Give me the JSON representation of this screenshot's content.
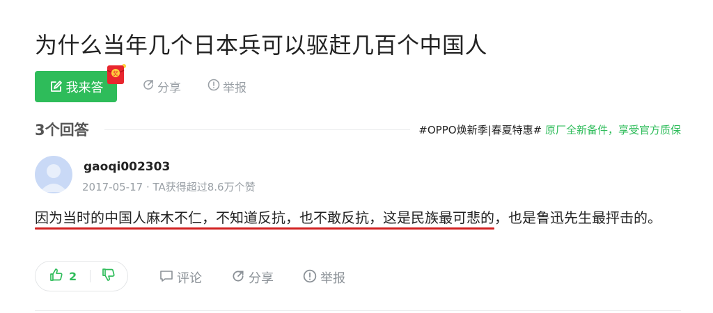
{
  "question": {
    "title": "为什么当年几个日本兵可以驱赶几百个中国人"
  },
  "actions": {
    "answer_label": "我来答",
    "share_label": "分享",
    "report_label": "举报",
    "redpacket_char": "奖"
  },
  "answers_header": {
    "count_label": "3个回答",
    "ad_tag": "#OPPO焕新季|春夏特惠#",
    "ad_text": "原厂全新备件，享受官方质保"
  },
  "answer": {
    "username": "gaoqi002303",
    "meta": "2017-05-17 · TA获得超过8.6万个赞",
    "text_highlighted": "因为当时的中国人麻木不仁，不知道反抗，也不敢反抗，这是民族最可悲的",
    "text_rest": "，也是鲁迅先生最抨击的。",
    "likes": "2",
    "comment_label": "评论",
    "share_label": "分享",
    "report_label": "举报"
  },
  "colors": {
    "accent_green": "#2ebc5a",
    "highlight_red": "#d11f1f",
    "muted_gray": "#9aa0a6"
  },
  "icons": [
    "edit-icon",
    "redpacket-icon",
    "share-icon",
    "report-icon",
    "thumbs-up-icon",
    "thumbs-down-icon",
    "comment-icon"
  ]
}
